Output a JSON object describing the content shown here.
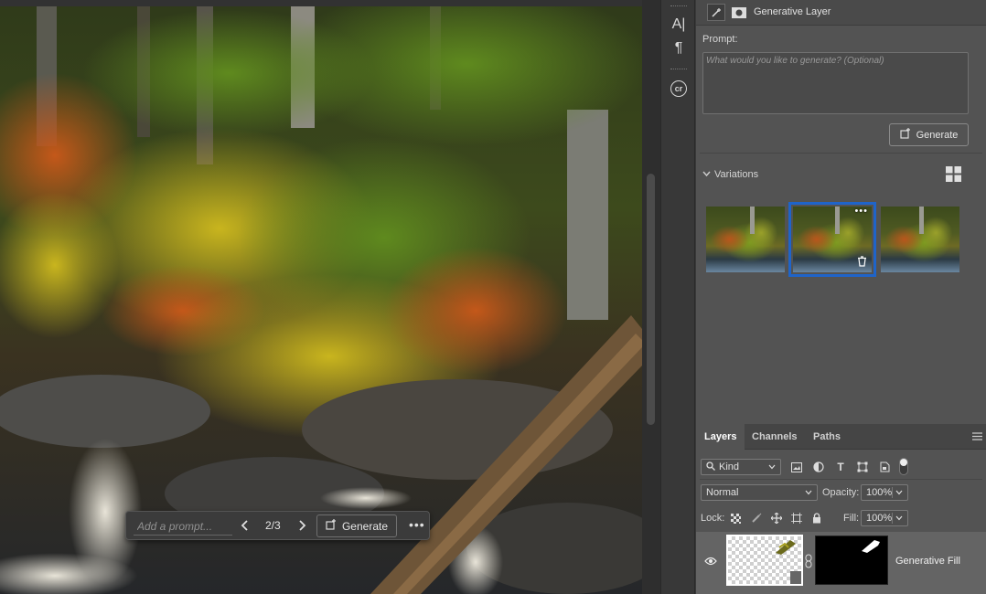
{
  "canvas": {
    "context_bar": {
      "prompt_placeholder": "Add a prompt...",
      "counter": "2/3",
      "generate_label": "Generate",
      "prev_icon": "chevron-left",
      "next_icon": "chevron-right",
      "more_icon": "ellipsis"
    }
  },
  "toolstrip": {
    "tools": [
      {
        "name": "character-panel",
        "glyph": "A|"
      },
      {
        "name": "paragraph-panel",
        "glyph": "¶"
      },
      {
        "name": "content-credentials",
        "glyph": "cr"
      }
    ]
  },
  "gen_panel": {
    "title": "Generative Layer",
    "prompt_label": "Prompt:",
    "prompt_placeholder": "What would you like to generate? (Optional)",
    "generate_label": "Generate",
    "variations_label": "Variations",
    "variations_count": 3,
    "selected_variation": 2
  },
  "layers_panel": {
    "tabs": [
      "Layers",
      "Channels",
      "Paths"
    ],
    "active_tab": "Layers",
    "filter_kind": "Kind",
    "blend_mode": "Normal",
    "opacity_label": "Opacity:",
    "opacity_value": "100%",
    "lock_label": "Lock:",
    "fill_label": "Fill:",
    "fill_value": "100%",
    "layer_name": "Generative Fill"
  },
  "colors": {
    "accent": "#1f64c9",
    "panel_bg": "#535353"
  }
}
